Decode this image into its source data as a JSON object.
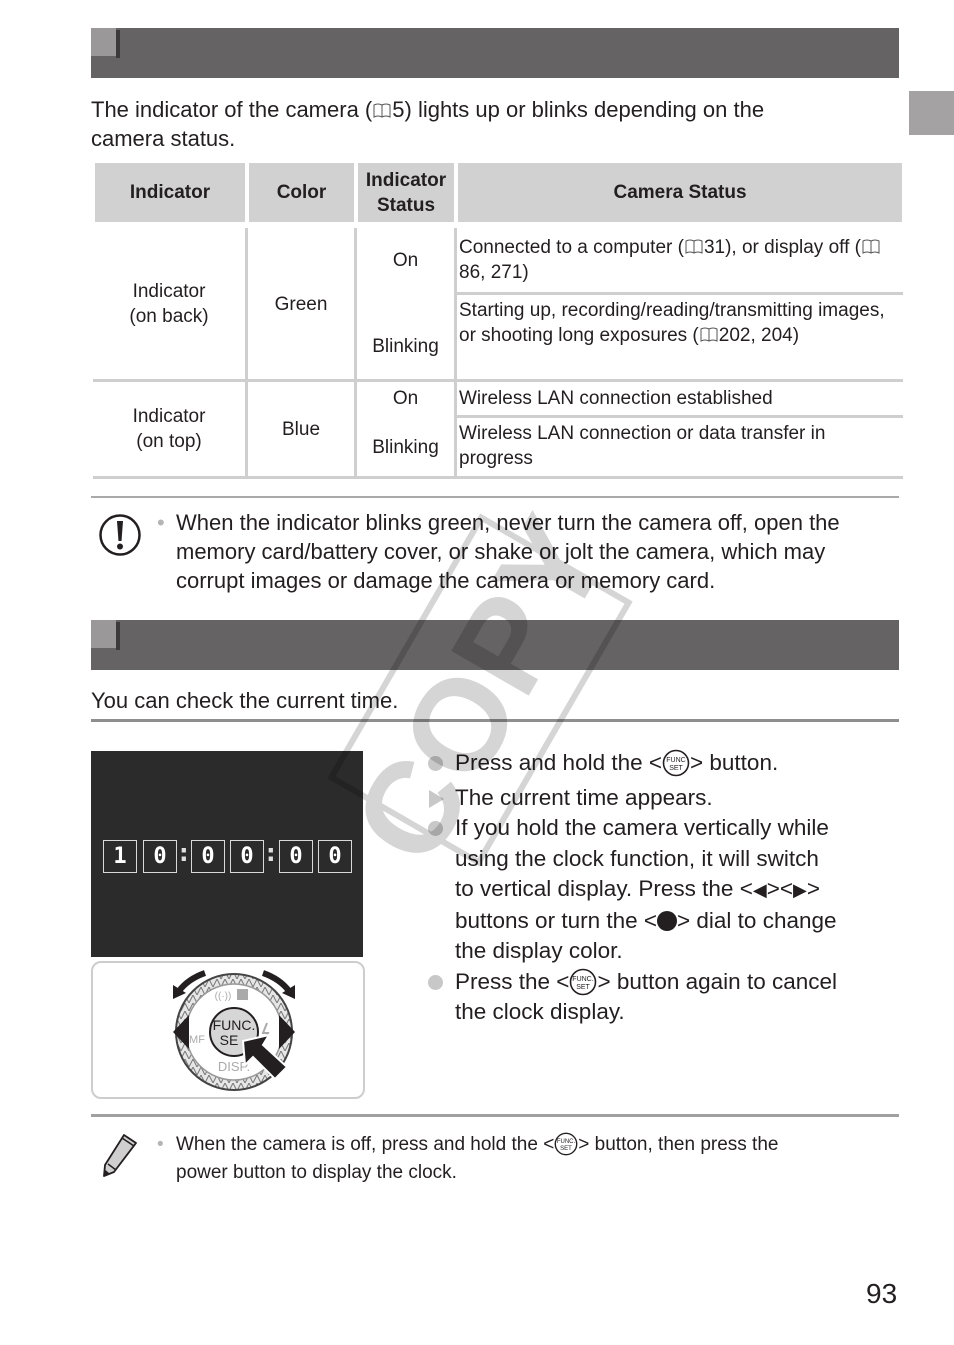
{
  "page": {
    "number": "93",
    "watermark": "COPY"
  },
  "section1": {
    "intro_pre": "The indicator of the camera (",
    "intro_ref": "5",
    "intro_post": ") lights up or blinks depending on the",
    "intro_line2": "camera status.",
    "table": {
      "headers": [
        "Indicator",
        "Color",
        "Indicator Status",
        "Camera Status"
      ],
      "header_status_line1": "Indicator",
      "header_status_line2": "Status",
      "groups": [
        {
          "indicator_line1": "Indicator",
          "indicator_line2": "(on back)",
          "color": "Green",
          "rows": [
            {
              "status": "On",
              "desc_pre": "Connected to a computer (",
              "ref1": "31",
              "desc_mid": "), or display off (",
              "ref2": "86, 271",
              "desc_post": ")"
            },
            {
              "status": "Blinking",
              "desc_pre": "Starting up, recording/reading/transmitting images, or shooting long exposures (",
              "ref1": "202, 204",
              "desc_post": ")"
            }
          ]
        },
        {
          "indicator_line1": "Indicator",
          "indicator_line2": "(on top)",
          "color": "Blue",
          "rows": [
            {
              "status": "On",
              "desc": "Wireless LAN connection established"
            },
            {
              "status": "Blinking",
              "desc": "Wireless LAN connection or data transfer in progress"
            }
          ]
        }
      ]
    },
    "caution": {
      "icon": "caution-icon",
      "text": "When the indicator blinks green, never turn the camera off, open the memory card/battery cover, or shake or jolt the camera, which may corrupt images or damage the camera or memory card."
    }
  },
  "section2": {
    "intro": "You can check the current time.",
    "clock_display": [
      "1",
      "0",
      "0",
      "0",
      "0",
      "0"
    ],
    "dial_labels": {
      "center_top": "FUNC.",
      "center_bottom": "SE",
      "bottom": "DISP.",
      "left": "MF",
      "top_icons": "((↑))"
    },
    "steps": [
      {
        "type": "bullet",
        "pre": "Press and hold the <",
        "post": "> button."
      },
      {
        "type": "result",
        "text": "The current time appears."
      },
      {
        "type": "bullet",
        "text": "If you hold the camera vertically while using the clock function, it will switch to vertical display. Press the <◀><▶> buttons or turn the <●> dial to change the display color."
      },
      {
        "type": "bullet",
        "pre": "Press the <",
        "post": "> button again to cancel the clock display."
      }
    ],
    "step3_line1": "If you hold the camera vertically while",
    "step3_line2": "using the clock function, it will switch",
    "step3_line3a": "to vertical display. Press the <",
    "step3_line3b": "><",
    "step3_line3c": ">",
    "step3_line4a": "buttons or turn the <",
    "step3_line4b": "> dial to change",
    "step3_line5": "the display color.",
    "step4_line2": "the clock display.",
    "note": {
      "icon": "pencil-icon",
      "pre": "When the camera is off, press and hold the <",
      "post": "> button, then press the",
      "line2": "power button to display the clock."
    },
    "func_icon_top": "FUNC",
    "func_icon_bottom": "SET"
  }
}
